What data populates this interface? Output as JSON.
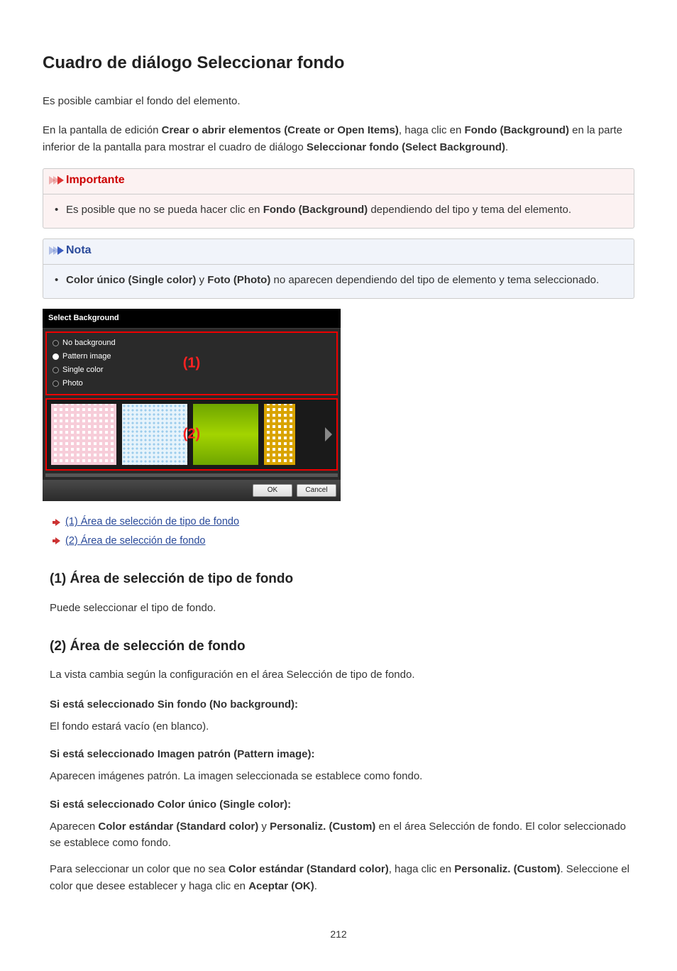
{
  "title": "Cuadro de diálogo Seleccionar fondo",
  "intro": "Es posible cambiar el fondo del elemento.",
  "para2_a": "En la pantalla de edición ",
  "para2_b": "Crear o abrir elementos (Create or Open Items)",
  "para2_c": ", haga clic en ",
  "para2_d": "Fondo (Background)",
  "para2_e": " en la parte inferior de la pantalla para mostrar el cuadro de diálogo ",
  "para2_f": "Seleccionar fondo (Select Background)",
  "para2_g": ".",
  "important": {
    "title": "Importante",
    "item_a": "Es posible que no se pueda hacer clic en ",
    "item_b": "Fondo (Background)",
    "item_c": " dependiendo del tipo y tema del elemento."
  },
  "note": {
    "title": "Nota",
    "item_a": "Color único (Single color)",
    "item_b": " y ",
    "item_c": "Foto (Photo)",
    "item_d": " no aparecen dependiendo del tipo de elemento y tema seleccionado."
  },
  "dialog": {
    "title": "Select Background",
    "radios": [
      "No background",
      "Pattern image",
      "Single color",
      "Photo"
    ],
    "num1": "(1)",
    "num2": "(2)",
    "ok": "OK",
    "cancel": "Cancel"
  },
  "links": {
    "l1": "(1) Área de selección de tipo de fondo",
    "l2": "(2) Área de selección de fondo"
  },
  "section1": {
    "heading": "(1) Área de selección de tipo de fondo",
    "body": "Puede seleccionar el tipo de fondo."
  },
  "section2": {
    "heading": "(2) Área de selección de fondo",
    "body": "La vista cambia según la configuración en el área Selección de tipo de fondo.",
    "dt1": "Si está seleccionado Sin fondo (No background):",
    "dd1": "El fondo estará vacío (en blanco).",
    "dt2": "Si está seleccionado Imagen patrón (Pattern image):",
    "dd2": "Aparecen imágenes patrón. La imagen seleccionada se establece como fondo.",
    "dt3": "Si está seleccionado Color único (Single color):",
    "dd3a_a": "Aparecen ",
    "dd3a_b": "Color estándar (Standard color)",
    "dd3a_c": " y ",
    "dd3a_d": "Personaliz. (Custom)",
    "dd3a_e": " en el área Selección de fondo. El color seleccionado se establece como fondo.",
    "dd3b_a": "Para seleccionar un color que no sea ",
    "dd3b_b": "Color estándar (Standard color)",
    "dd3b_c": ", haga clic en ",
    "dd3b_d": "Personaliz. (Custom)",
    "dd3b_e": ". Seleccione el color que desee establecer y haga clic en ",
    "dd3b_f": "Aceptar (OK)",
    "dd3b_g": "."
  },
  "pageNumber": "212"
}
